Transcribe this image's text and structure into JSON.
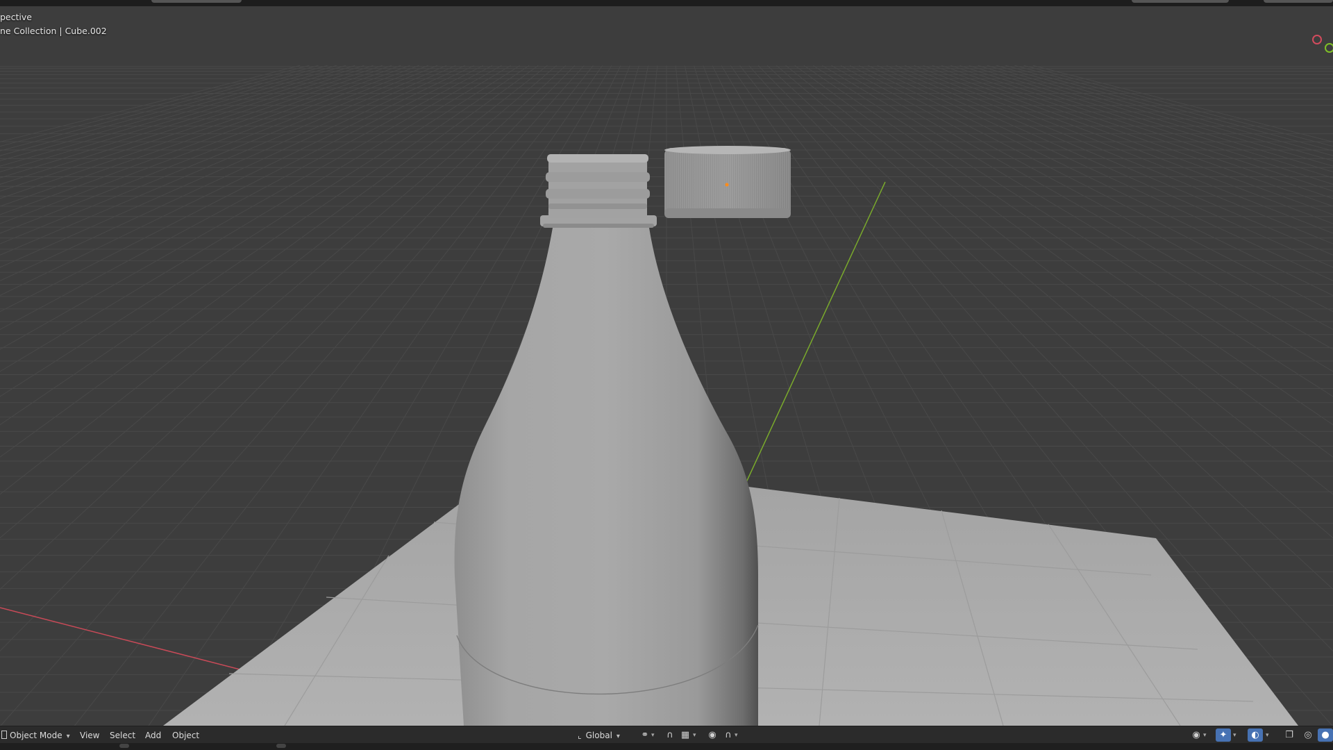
{
  "viewport": {
    "view_label": "pective",
    "collection_label": "ne Collection | Cube.002"
  },
  "header": {
    "mode": "Object Mode",
    "menus": [
      "View",
      "Select",
      "Add",
      "Object"
    ],
    "orientation": "Global"
  },
  "icons": {
    "mode": "object-mode-icon",
    "orientation": "transform-orientation-icon",
    "pivot": "pivot-point-icon",
    "snap": "snap-magnet-icon",
    "snap_target": "snap-increment-icon",
    "proportional": "proportional-editing-icon",
    "falloff": "falloff-curve-icon",
    "visibility": "object-visibility-icon",
    "gizmo": "viewport-gizmo-icon",
    "overlay": "overlays-icon",
    "xray": "xray-icon",
    "wireframe": "wireframe-shading-icon",
    "solid": "solid-shading-icon"
  },
  "colors": {
    "background": "#3d3d3d",
    "grid": "#4a4a4a",
    "x_axis": "#d24b5d",
    "y_axis": "#7fbf27",
    "header": "#2b2b2b",
    "active_button": "#4772b3",
    "model": "#a9a9a9",
    "plane": "#b0b0b0",
    "origin_dot": "#ff8c1a"
  }
}
